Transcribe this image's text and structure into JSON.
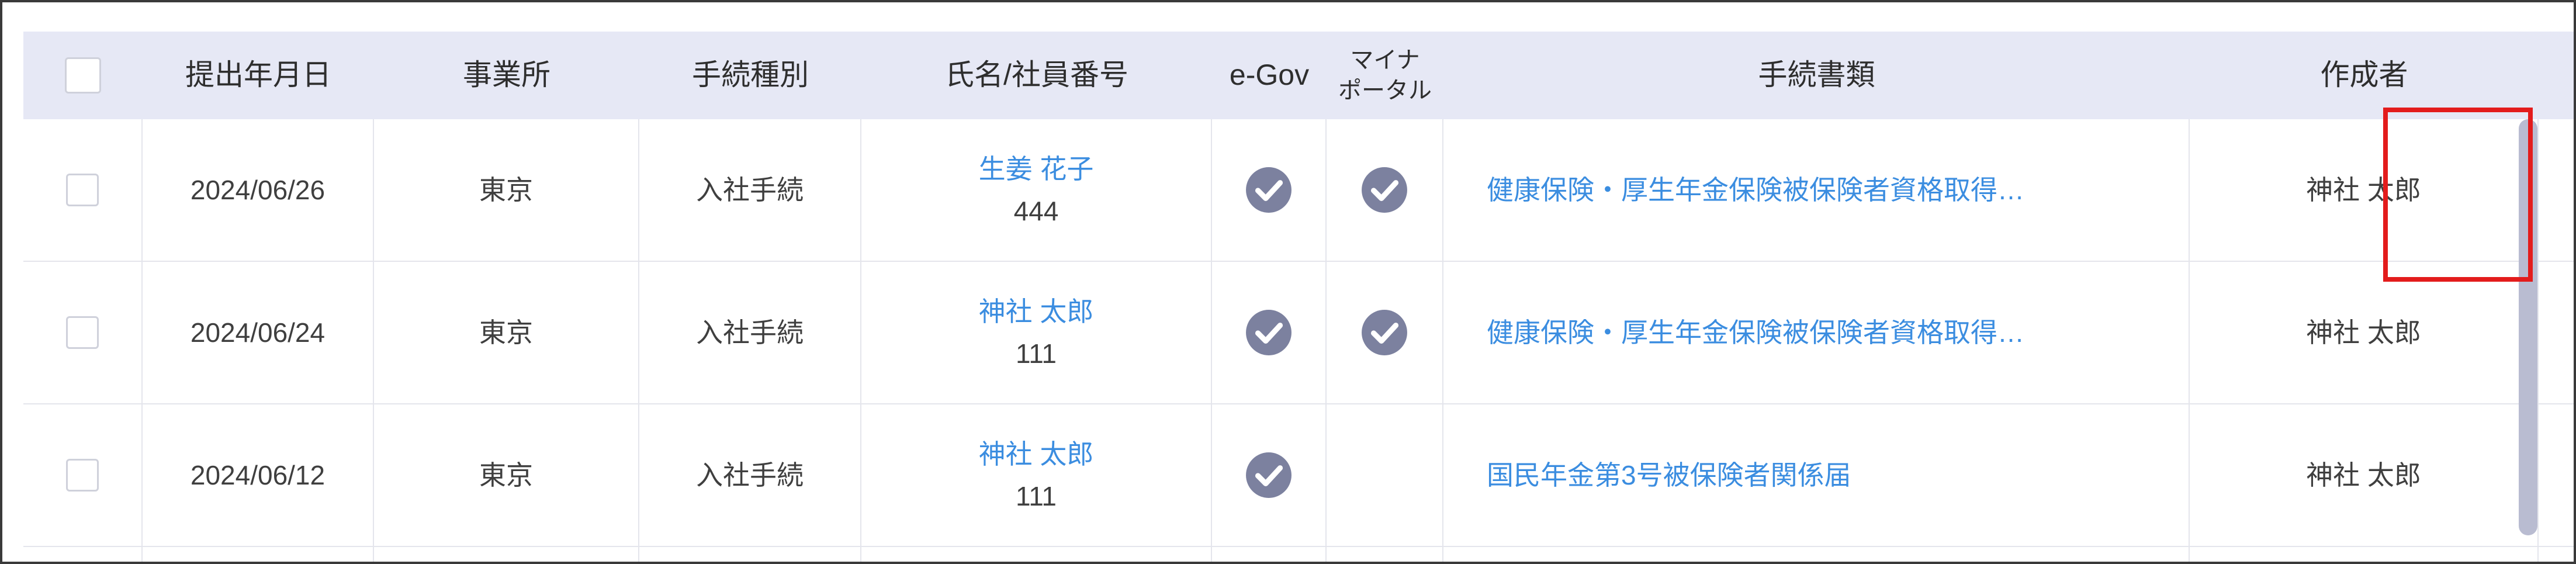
{
  "table": {
    "headers": {
      "submitted_date": "提出年月日",
      "office": "事業所",
      "procedure_type": "手続種別",
      "name_employee_no": "氏名/社員番号",
      "egov": "e-Gov",
      "myna_line1": "マイナ",
      "myna_line2": "ポータル",
      "documents": "手続書類",
      "author": "作成者"
    },
    "rows": [
      {
        "date": "2024/06/26",
        "office": "東京",
        "procedure": "入社手続",
        "name": "生姜 花子",
        "employee_no": "444",
        "egov_done": true,
        "myna_done": true,
        "document": "健康保険・厚生年金保険被保険者資格取得…",
        "author": "神社 太郎"
      },
      {
        "date": "2024/06/24",
        "office": "東京",
        "procedure": "入社手続",
        "name": "神社 太郎",
        "employee_no": "111",
        "egov_done": true,
        "myna_done": true,
        "document": "健康保険・厚生年金保険被保険者資格取得…",
        "author": "神社 太郎"
      },
      {
        "date": "2024/06/12",
        "office": "東京",
        "procedure": "入社手続",
        "name": "神社 太郎",
        "employee_no": "111",
        "egov_done": true,
        "myna_done": false,
        "document": "国民年金第3号被保険者関係届",
        "author": "神社 太郎"
      }
    ]
  },
  "colors": {
    "header_bg": "#e6e8f5",
    "link": "#3b8de0",
    "check_icon": "#7c819f",
    "highlight": "#e31c1c",
    "scrollbar": "#b9bcd1"
  },
  "icons": {
    "status_done": "check-circle-icon",
    "row_menu": "more-vertical-icon"
  }
}
